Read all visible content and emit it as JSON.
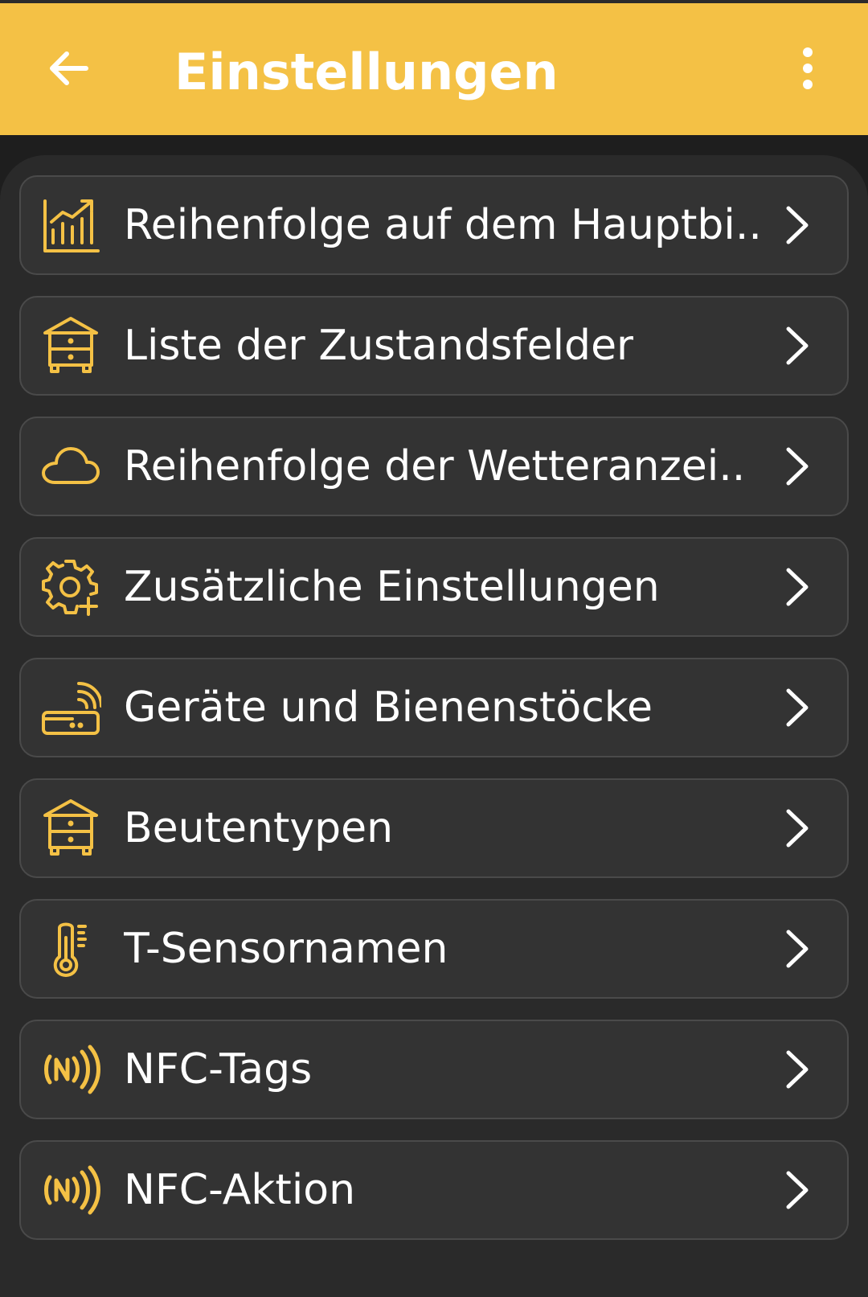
{
  "appbar": {
    "title": "Einstellungen",
    "back_icon": "arrow-left-icon",
    "menu_icon": "more-vertical-icon",
    "background": "#f4c145"
  },
  "colors": {
    "accent": "#f4c145",
    "item_bg": "#333333",
    "panel_bg": "#2a2a2a",
    "text": "#ffffff"
  },
  "items": [
    {
      "label": "Reihenfolge auf dem Hauptbi..",
      "icon": "chart-growth-icon"
    },
    {
      "label": "Liste der Zustandsfelder",
      "icon": "beehive-icon"
    },
    {
      "label": "Reihenfolge der Wetteranzei..",
      "icon": "cloud-icon"
    },
    {
      "label": "Zusätzliche Einstellungen",
      "icon": "gear-plus-icon"
    },
    {
      "label": "Geräte und Bienenstöcke",
      "icon": "router-wifi-icon"
    },
    {
      "label": "Beutentypen",
      "icon": "beehive-icon"
    },
    {
      "label": "T-Sensornamen",
      "icon": "thermometer-icon"
    },
    {
      "label": "NFC-Tags",
      "icon": "nfc-icon"
    },
    {
      "label": "NFC-Aktion",
      "icon": "nfc-icon"
    }
  ]
}
